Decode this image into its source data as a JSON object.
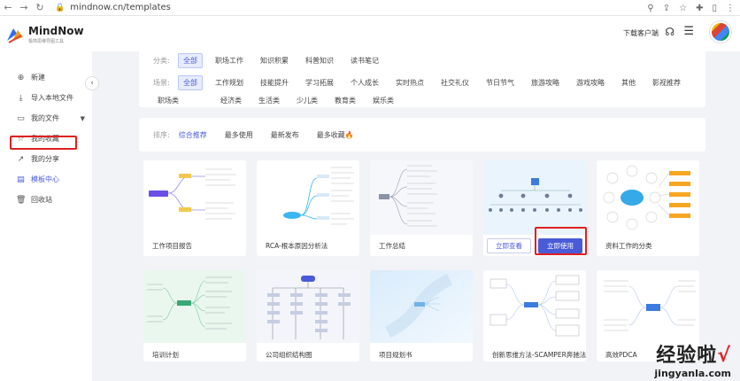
{
  "browser": {
    "url": "mindnow.cn/templates",
    "back_icon": "back-arrow-icon",
    "forward_icon": "forward-arrow-icon",
    "reload_icon": "reload-icon"
  },
  "brand": {
    "name": "MindNow",
    "tagline": "极简思维导图工具"
  },
  "sidebar": {
    "items": [
      {
        "label": "新建",
        "icon": "plus-circle-icon"
      },
      {
        "label": "导入本地文件",
        "icon": "import-icon"
      },
      {
        "label": "我的文件",
        "icon": "folder-icon"
      },
      {
        "label": "我的收藏",
        "icon": "star-icon"
      },
      {
        "label": "我的分享",
        "icon": "share-icon"
      },
      {
        "label": "模板中心",
        "icon": "template-icon"
      },
      {
        "label": "回收站",
        "icon": "trash-icon"
      }
    ],
    "active_index": 5
  },
  "header": {
    "download_label": "下载客户端"
  },
  "filters": {
    "category_label": "分类:",
    "categories": [
      "全部",
      "职场工作",
      "知识积累",
      "科普知识",
      "读书笔记"
    ],
    "category_selected": 0,
    "scene_label": "场景:",
    "scenes": [
      "全部",
      "工作规划",
      "技能提升",
      "学习拓展",
      "个人成长",
      "实时热点",
      "社交礼仪",
      "节日节气",
      "旅游攻略",
      "游戏攻略",
      "其他",
      "影视推荐",
      "职场类",
      "经济类",
      "生活类",
      "少儿类",
      "教育类",
      "娱乐类"
    ],
    "scene_selected": 0
  },
  "sort": {
    "label": "排序:",
    "options": [
      "综合推荐",
      "最多使用",
      "最新发布",
      "最多收藏"
    ],
    "selected": 0
  },
  "cards": [
    {
      "title": "工作项目报告"
    },
    {
      "title": "RCA-根本原因分析法"
    },
    {
      "title": "工作总结"
    },
    {
      "title": ""
    },
    {
      "title": "资料工作的分类"
    },
    {
      "title": "培训计划"
    },
    {
      "title": "公司组织结构图"
    },
    {
      "title": "项目规划书"
    },
    {
      "title": "创新思维方法-SCAMPER奔驰法"
    },
    {
      "title": "高效PDCA"
    }
  ],
  "hover_card": {
    "preview_label": "立即查看",
    "use_label": "立即使用"
  },
  "watermark": {
    "main": "经验啦",
    "check": "√",
    "sub": "jingyanla.com"
  },
  "colors": {
    "accent": "#4a5bd8",
    "highlight_box": "#e02020",
    "page_bg": "#f2f3f7"
  }
}
